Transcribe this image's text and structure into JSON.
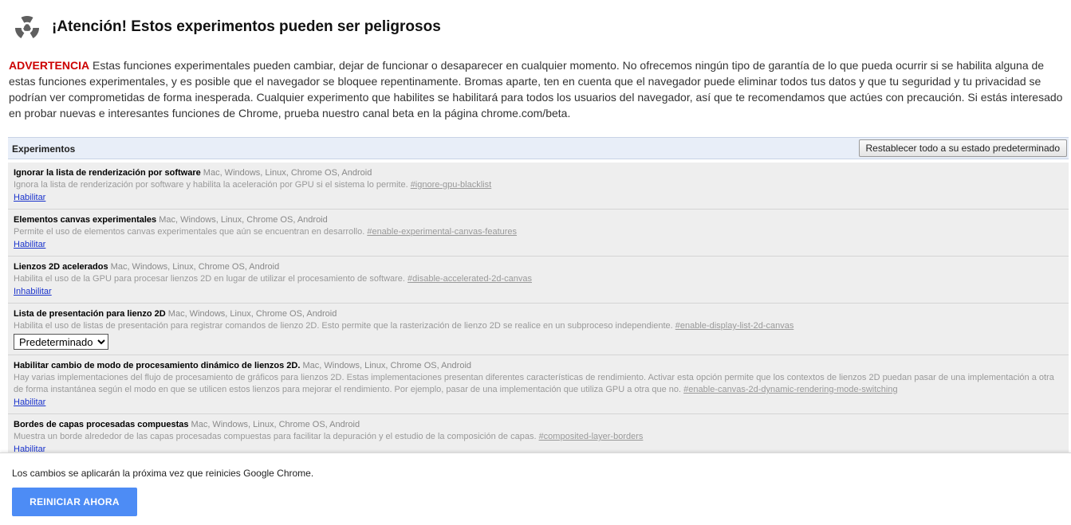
{
  "header": {
    "icon": "radiation-hazard-icon",
    "title": "¡Atención! Estos experimentos pueden ser peligrosos"
  },
  "warning": {
    "label": "ADVERTENCIA",
    "text": " Estas funciones experimentales pueden cambiar, dejar de funcionar o desaparecer en cualquier momento. No ofrecemos ningún tipo de garantía de lo que pueda ocurrir si se habilita alguna de estas funciones experimentales, y es posible que el navegador se bloquee repentinamente. Bromas aparte, ten en cuenta que el navegador puede eliminar todos tus datos y que tu seguridad y tu privacidad se podrían ver comprometidas de forma inesperada. Cualquier experimento que habilites se habilitará para todos los usuarios del navegador, así que te recomendamos que actúes con precaución. Si estás interesado en probar nuevas e interesantes funciones de Chrome, prueba nuestro canal beta en la página chrome.com/beta."
  },
  "experiments_header": {
    "label": "Experimentos",
    "reset_label": "Restablecer todo a su estado predeterminado"
  },
  "experiments": [
    {
      "name": "Ignorar la lista de renderización por software",
      "platforms": " Mac, Windows, Linux, Chrome OS, Android",
      "description": "Ignora la lista de renderización por software y habilita la aceleración por GPU si el sistema lo permite. ",
      "anchor": "#ignore-gpu-blacklist",
      "action": "Habilitar"
    },
    {
      "name": "Elementos canvas experimentales",
      "platforms": " Mac, Windows, Linux, Chrome OS, Android",
      "description": "Permite el uso de elementos canvas experimentales que aún se encuentran en desarrollo. ",
      "anchor": "#enable-experimental-canvas-features",
      "action": "Habilitar"
    },
    {
      "name": "Lienzos 2D acelerados",
      "platforms": " Mac, Windows, Linux, Chrome OS, Android",
      "description": "Habilita el uso de la GPU para procesar lienzos 2D en lugar de utilizar el procesamiento de software. ",
      "anchor": "#disable-accelerated-2d-canvas",
      "action": "Inhabilitar"
    },
    {
      "name": "Lista de presentación para lienzo 2D",
      "platforms": " Mac, Windows, Linux, Chrome OS, Android",
      "description": "Habilita el uso de listas de presentación para registrar comandos de lienzo 2D. Esto permite que la rasterización de lienzo 2D se realice en un subproceso independiente. ",
      "anchor": "#enable-display-list-2d-canvas",
      "select_value": "Predeterminado"
    },
    {
      "name": "Habilitar cambio de modo de procesamiento dinámico de lienzos 2D.",
      "platforms": " Mac, Windows, Linux, Chrome OS, Android",
      "description": "Hay varias implementaciones del flujo de procesamiento de gráficos para lienzos 2D. Estas implementaciones presentan diferentes características de rendimiento. Activar esta opción permite que los contextos de lienzos 2D puedan pasar de una implementación a otra de forma instantánea según el modo en que se utilicen estos lienzos para mejorar el rendimiento. Por ejemplo, pasar de una implementación que utiliza GPU a otra que no. ",
      "anchor": "#enable-canvas-2d-dynamic-rendering-mode-switching",
      "action": "Habilitar"
    },
    {
      "name": "Bordes de capas procesadas compuestas",
      "platforms": " Mac, Windows, Linux, Chrome OS, Android",
      "description": "Muestra un borde alrededor de las capas procesadas compuestas para facilitar la depuración y el estudio de la composición de capas. ",
      "anchor": "#composited-layer-borders",
      "action": "Habilitar"
    }
  ],
  "footer": {
    "note": "Los cambios se aplicarán la próxima vez que reinicies Google Chrome.",
    "restart_label": "REINICIAR AHORA"
  }
}
